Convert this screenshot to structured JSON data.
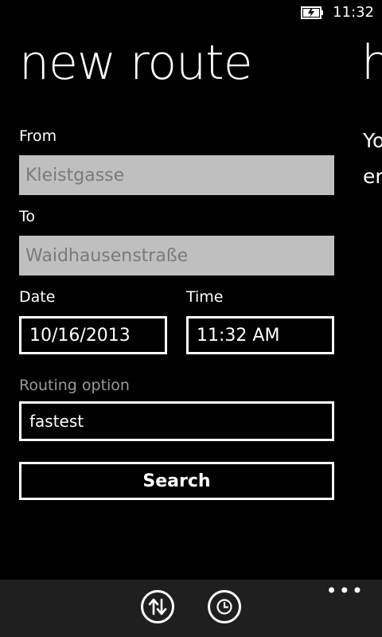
{
  "status": {
    "time": "11:32"
  },
  "page": {
    "title": "new route",
    "next_title_fragment": "h",
    "next_text_line1": "Yo",
    "next_text_line2": "er"
  },
  "form": {
    "from_label": "From",
    "from_value": "Kleistgasse",
    "to_label": "To",
    "to_value": "Waidhausenstraße",
    "date_label": "Date",
    "date_value": "10/16/2013",
    "time_label": "Time",
    "time_value": "11:32 AM",
    "routing_label": "Routing option",
    "routing_value": "fastest",
    "search_label": "Search"
  },
  "app_bar": {
    "ellipsis": "•••",
    "icons": [
      "swap-direction-icon",
      "clock-icon"
    ]
  },
  "colors": {
    "background": "#000000",
    "textbox": "#bfbfbf",
    "appbar": "#1f1f1f",
    "muted": "#9a9a9a"
  }
}
